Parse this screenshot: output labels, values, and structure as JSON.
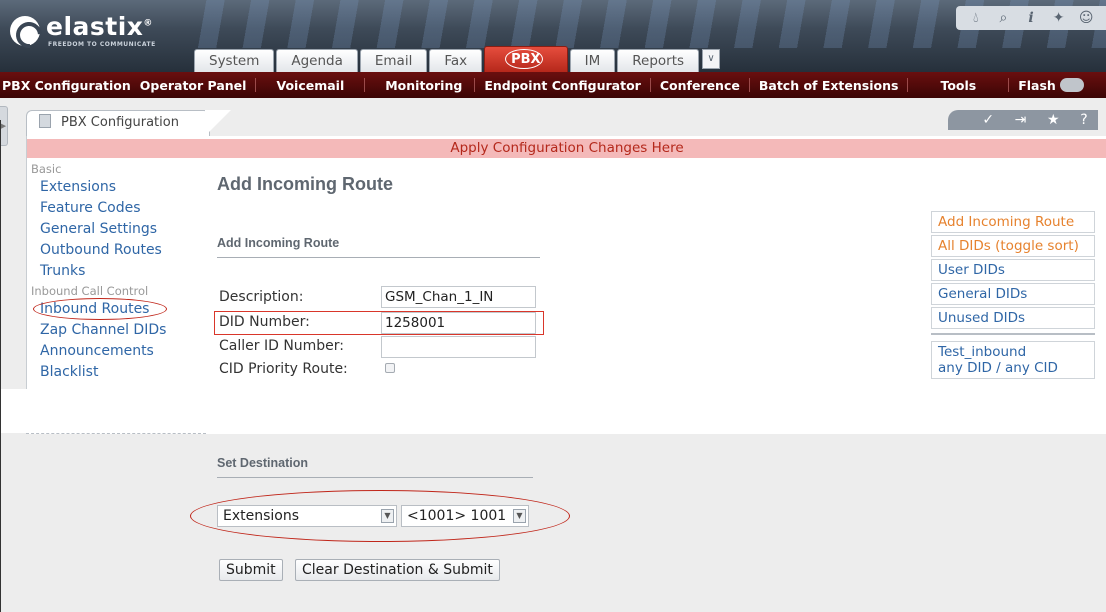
{
  "brand": {
    "name": "elastix",
    "registered": "®",
    "tagline": "FREEDOM TO COMMUNICATE"
  },
  "top_icons": [
    "drop-icon",
    "search-icon",
    "info-icon",
    "puzzle-icon",
    "user-icon"
  ],
  "main_tabs": [
    {
      "label": "System",
      "active": false
    },
    {
      "label": "Agenda",
      "active": false
    },
    {
      "label": "Email",
      "active": false
    },
    {
      "label": "Fax",
      "active": false
    },
    {
      "label": "PBX",
      "active": true
    },
    {
      "label": "IM",
      "active": false
    },
    {
      "label": "Reports",
      "active": false
    }
  ],
  "module_menu": {
    "items": [
      "PBX Configuration",
      "Operator Panel",
      "Voicemail",
      "Monitoring",
      "Endpoint Configurator",
      "Conference",
      "Batch of Extensions",
      "Tools",
      "Flash"
    ]
  },
  "module_tab": {
    "label": "PBX Configuration"
  },
  "module_tools": [
    "edit-icon",
    "pin-icon",
    "star-icon",
    "help-icon"
  ],
  "apply_bar": {
    "text": "Apply Configuration Changes Here"
  },
  "left_nav": {
    "group_basic": "Basic",
    "basic_items": [
      "Extensions",
      "Feature Codes",
      "General Settings",
      "Outbound Routes",
      "Trunks"
    ],
    "group_inbound": "Inbound Call Control",
    "inbound_items": [
      "Inbound Routes",
      "Zap Channel DIDs",
      "Announcements",
      "Blacklist"
    ]
  },
  "form": {
    "title": "Add Incoming Route",
    "section1": "Add Incoming Route",
    "description_label": "Description:",
    "description_value": "GSM_Chan_1_IN",
    "did_label": "DID Number:",
    "did_value": "1258001",
    "callerid_label": "Caller ID Number:",
    "callerid_value": "",
    "cid_priority_label": "CID Priority Route:",
    "cid_priority_checked": false,
    "section2": "Set Destination",
    "dest_type": "Extensions",
    "dest_value": "<1001> 1001",
    "submit": "Submit",
    "clear_submit": "Clear Destination & Submit"
  },
  "right_nav": {
    "items": [
      {
        "label": "Add Incoming Route",
        "style": "orange"
      },
      {
        "label": "All DIDs (toggle sort)",
        "style": "orange"
      },
      {
        "label": "User DIDs",
        "style": "blue"
      },
      {
        "label": "General DIDs",
        "style": "blue"
      },
      {
        "label": "Unused DIDs",
        "style": "blue"
      }
    ],
    "route_line1": "Test_inbound",
    "route_line2": "any DID / any CID"
  },
  "colors": {
    "header_dark": "#26303b",
    "pbx_tab": "#c83224",
    "module_bar": "#4a0808",
    "apply_bar_bg": "#f4b9b9",
    "link": "#2f66a6",
    "link_orange": "#e6822e",
    "annotation_red": "#c0261a"
  }
}
